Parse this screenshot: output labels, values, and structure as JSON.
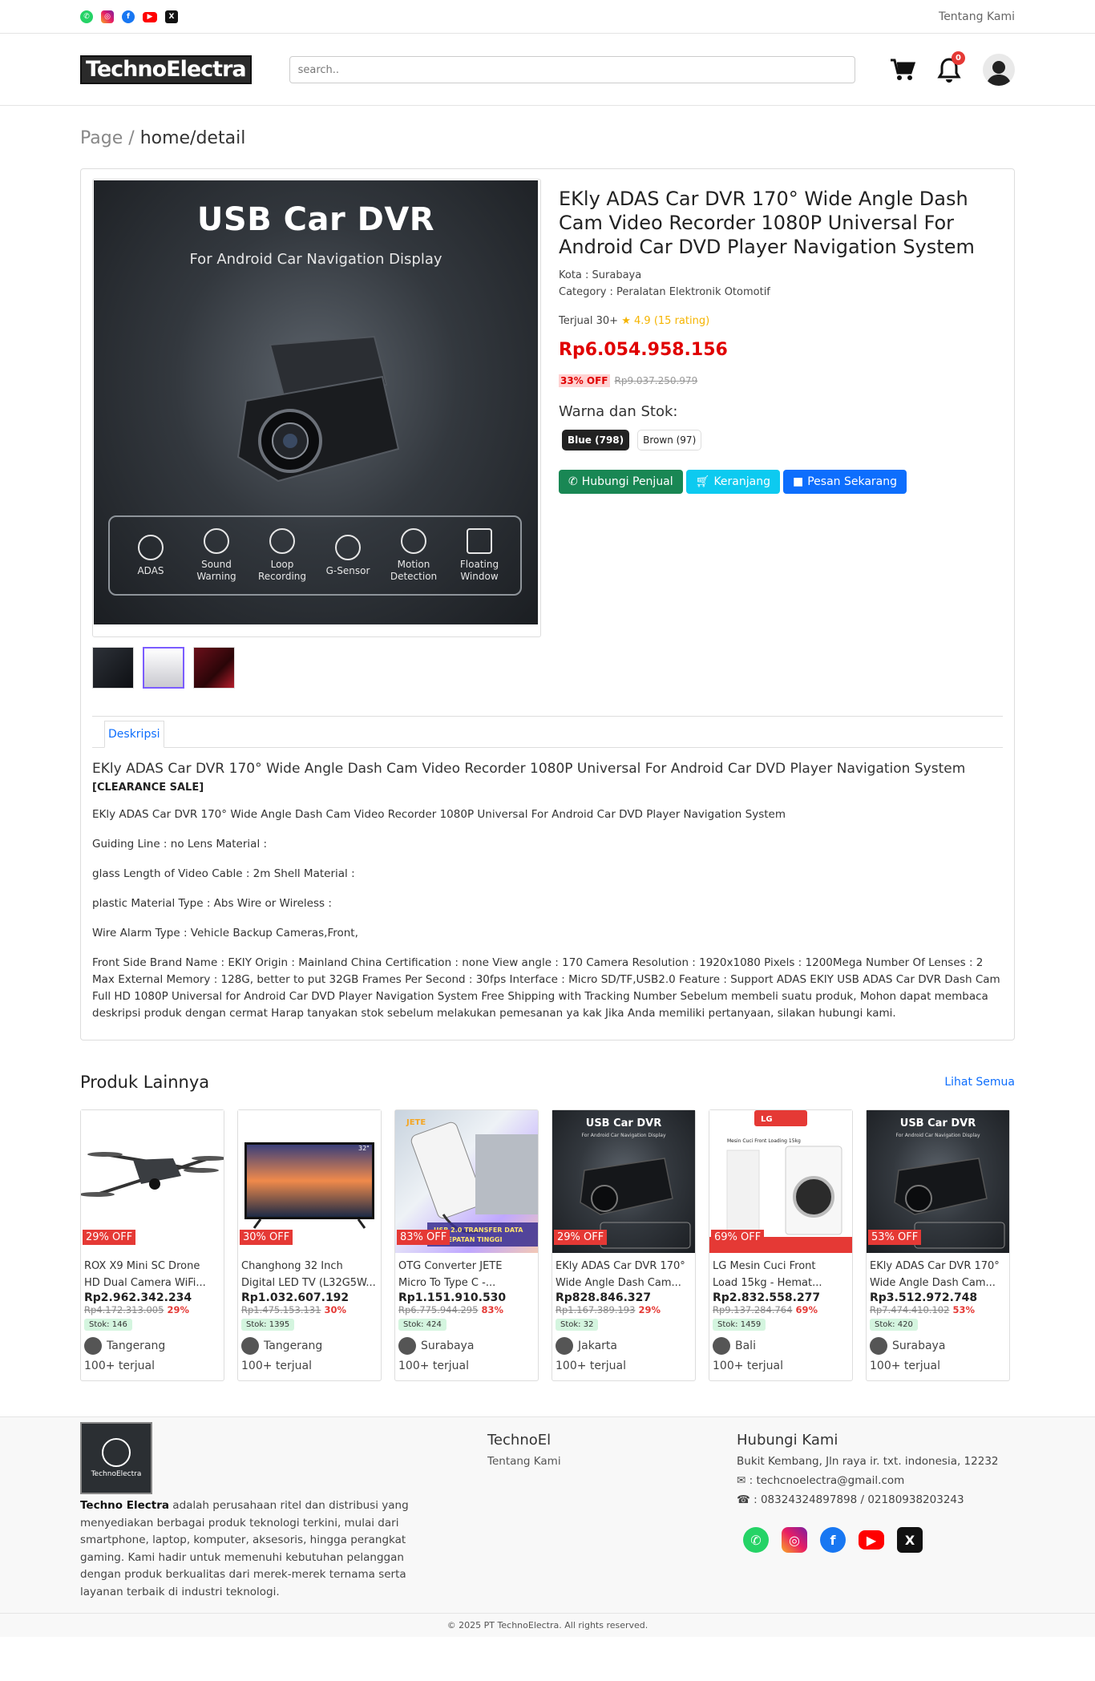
{
  "topbar": {
    "social_icons": [
      "whatsapp-icon",
      "instagram-icon",
      "facebook-icon",
      "youtube-icon",
      "x-icon"
    ],
    "about_link": "Tentang Kami"
  },
  "header": {
    "logo": "TechnoElectra",
    "search_placeholder": "search..",
    "notification_count": "0"
  },
  "breadcrumb": {
    "root": "Page",
    "sep": "/",
    "current": "home/detail"
  },
  "product": {
    "image_title": "USB Car DVR",
    "image_subtitle": "For Android Car Navigation Display",
    "image_features": [
      "ADAS",
      "Sound Warning",
      "Loop Recording",
      "G-Sensor",
      "Motion Detection",
      "Floating Window"
    ],
    "title": "EKly ADAS Car DVR 170° Wide Angle Dash Cam Video Recorder 1080P Universal For Android Car DVD Player Navigation System",
    "city": "Kota : Surabaya",
    "category": "Category : Peralatan Elektronik Otomotif",
    "sold": "Terjual 30+",
    "rating": "4.9 (15 rating)",
    "price": "Rp6.054.958.156",
    "discount": "33% OFF",
    "old_price": "Rp9.037.250.979",
    "color_label": "Warna dan Stok:",
    "variants": [
      "Blue (798)",
      "Brown (97)"
    ],
    "buttons": {
      "chat": "Hubungi Penjual",
      "cart": "Keranjang",
      "order": "Pesan Sekarang"
    }
  },
  "tabs": {
    "desc": "Deskripsi"
  },
  "description": {
    "title": "EKly ADAS Car DVR 170° Wide Angle Dash Cam Video Recorder 1080P Universal For Android Car DVD Player Navigation System",
    "clearance": "[CLEARANCE SALE]",
    "paragraphs": [
      "EKly ADAS Car DVR 170° Wide Angle Dash Cam Video Recorder 1080P Universal For Android Car DVD Player Navigation System",
      "Guiding Line : no Lens Material :",
      " glass Length of Video Cable : 2m Shell Material :",
      "plastic Material Type : Abs Wire or Wireless :",
      "Wire Alarm Type : Vehicle Backup Cameras,Front,",
      "Front Side Brand Name : EKIY Origin : Mainland China Certification : none View angle : 170 Camera Resolution : 1920x1080 Pixels : 1200Mega Number Of Lenses : 2 Max External Memory : 128G, better to put 32GB Frames Per Second : 30fps Interface : Micro SD/TF,USB2.0 Feature : Support ADAS EKIY USB ADAS Car DVR Dash Cam Full HD 1080P Universal for Android Car DVD Player Navigation System Free Shipping with Tracking Number Sebelum membeli suatu produk, Mohon dapat membaca deskripsi produk dengan cermat Harap tanyakan stok sebelum melakukan pemesanan ya kak Jika Anda memiliki pertanyaan, silakan hubungi kami."
    ]
  },
  "related": {
    "title": "Produk Lainnya",
    "see_all": "Lihat Semua",
    "items": [
      {
        "off": "29% OFF",
        "name1": "ROX X9 Mini SC Drone",
        "name2": "HD Dual Camera WiFi...",
        "price": "Rp2.962.342.234",
        "old": "Rp4.172.313.005",
        "pct": "29%",
        "stock": "Stok: 146",
        "city": "Tangerang",
        "sold": "100+ terjual"
      },
      {
        "off": "30% OFF",
        "name1": "Changhong 32 Inch",
        "name2": "Digital LED TV (L32G5W...",
        "price": "Rp1.032.607.192",
        "old": "Rp1.475.153.131",
        "pct": "30%",
        "stock": "Stok: 1395",
        "city": "Tangerang",
        "sold": "100+ terjual"
      },
      {
        "off": "83% OFF",
        "name1": "OTG Converter JETE",
        "name2": "Micro To Type C -...",
        "price": "Rp1.151.910.530",
        "old": "Rp6.775.944.295",
        "pct": "83%",
        "stock": "Stok: 424",
        "city": "Surabaya",
        "sold": "100+ terjual"
      },
      {
        "off": "29% OFF",
        "name1": "EKly ADAS Car DVR 170°",
        "name2": "Wide Angle Dash Cam...",
        "price": "Rp828.846.327",
        "old": "Rp1.167.389.193",
        "pct": "29%",
        "stock": "Stok: 32",
        "city": "Jakarta",
        "sold": "100+ terjual"
      },
      {
        "off": "69% OFF",
        "name1": "LG Mesin Cuci Front",
        "name2": "Load 15kg - Hemat...",
        "price": "Rp2.832.558.277",
        "old": "Rp9.137.284.764",
        "pct": "69%",
        "stock": "Stok: 1459",
        "city": "Bali",
        "sold": "100+ terjual"
      },
      {
        "off": "53% OFF",
        "name1": "EKly ADAS Car DVR 170°",
        "name2": "Wide Angle Dash Cam...",
        "price": "Rp3.512.972.748",
        "old": "Rp7.474.410.102",
        "pct": "53%",
        "stock": "Stok: 420",
        "city": "Surabaya",
        "sold": "100+ terjual"
      }
    ],
    "img_title": "USB Car DVR",
    "img_sub": "For Android Car Navigation Display",
    "lg_logo": "LG",
    "lg_caption": "Mesin Cuci Front Loading 15kg",
    "tv_size": "32\"",
    "otg_label": "JETE",
    "otg_banner": "USB 2.0 TRANSFER DATA KECEPATAN TINGGI"
  },
  "footer": {
    "logo_text": "TechnoElectra",
    "about_bold": "Techno Electra",
    "about_text": " adalah perusahaan ritel dan distribusi yang menyediakan berbagai produk teknologi terkini, mulai dari smartphone, laptop, komputer, aksesoris, hingga perangkat gaming. Kami hadir untuk memenuhi kebutuhan pelanggan dengan produk berkualitas dari merek-merek ternama serta layanan terbaik di industri teknologi.",
    "col2_title": "TechnoEl",
    "col2_link": "Tentang Kami",
    "col3_title": "Hubungi Kami",
    "address": "Bukit Kembang, Jln raya ir. txt. indonesia, 12232",
    "email": ": techcnoelectra@gmail.com",
    "phone": ": 08324324897898 / 02180938203243",
    "copyright": "© 2025 PT TechnoElectra. All rights reserved."
  }
}
